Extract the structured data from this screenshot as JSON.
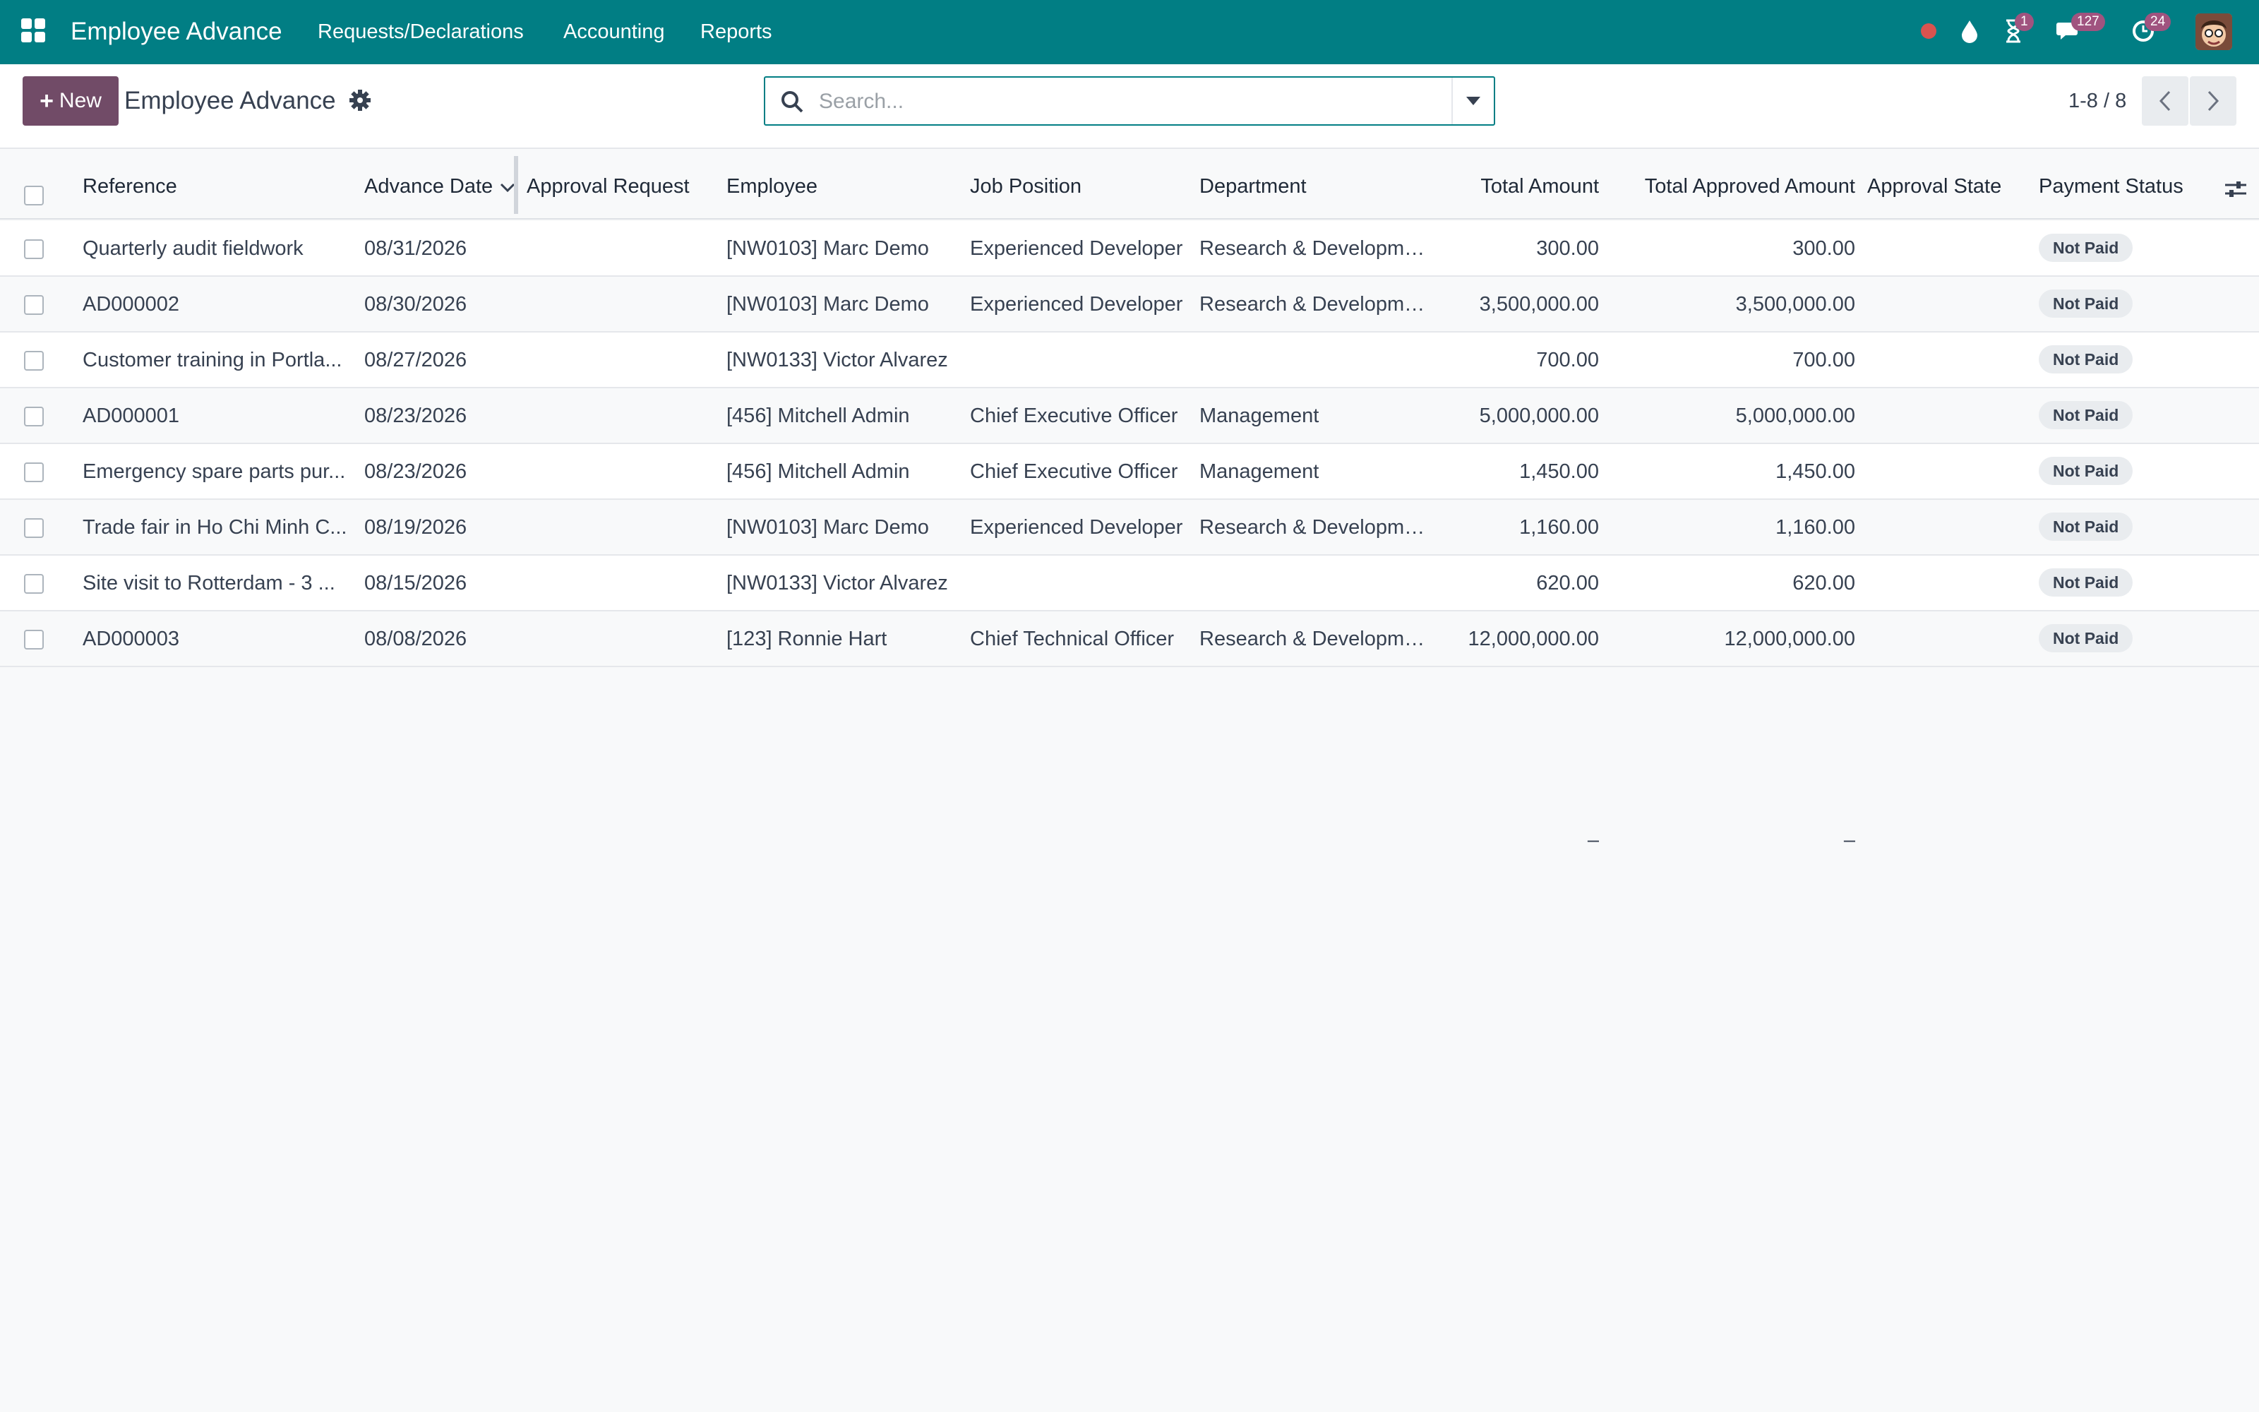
{
  "navbar": {
    "app_title": "Employee Advance",
    "menus": [
      "Requests/Declarations",
      "Accounting",
      "Reports"
    ],
    "activity_badge": "1",
    "messages_badge": "127",
    "updates_badge": "24",
    "brand_color": "#017e84"
  },
  "control_panel": {
    "new_label": "New",
    "breadcrumb": "Employee Advance",
    "search_placeholder": "Search...",
    "pager": "1-8 / 8",
    "accent_color": "#714b67"
  },
  "table": {
    "columns": {
      "reference": "Reference",
      "advance_date": "Advance Date",
      "approval_request": "Approval Request",
      "employee": "Employee",
      "job_position": "Job Position",
      "department": "Department",
      "total_amount": "Total Amount",
      "total_approved_amount": "Total Approved Amount",
      "approval_state": "Approval State",
      "payment_status": "Payment Status"
    },
    "rows": [
      {
        "reference": "Quarterly audit fieldwork",
        "date": "08/31/2026",
        "approval_request": "",
        "employee": "[NW0103] Marc Demo",
        "job": "Experienced Developer",
        "department": "Research & Development",
        "total": "300.00",
        "approved": "300.00",
        "approval_state": "",
        "payment": "Not Paid"
      },
      {
        "reference": "AD000002",
        "date": "08/30/2026",
        "approval_request": "",
        "employee": "[NW0103] Marc Demo",
        "job": "Experienced Developer",
        "department": "Research & Development",
        "total": "3,500,000.00",
        "approved": "3,500,000.00",
        "approval_state": "",
        "payment": "Not Paid"
      },
      {
        "reference": "Customer training in Portla...",
        "date": "08/27/2026",
        "approval_request": "",
        "employee": "[NW0133] Victor Alvarez",
        "job": "",
        "department": "",
        "total": "700.00",
        "approved": "700.00",
        "approval_state": "",
        "payment": "Not Paid"
      },
      {
        "reference": "AD000001",
        "date": "08/23/2026",
        "approval_request": "",
        "employee": "[456] Mitchell Admin",
        "job": "Chief Executive Officer",
        "department": "Management",
        "total": "5,000,000.00",
        "approved": "5,000,000.00",
        "approval_state": "",
        "payment": "Not Paid"
      },
      {
        "reference": "Emergency spare parts pur...",
        "date": "08/23/2026",
        "approval_request": "",
        "employee": "[456] Mitchell Admin",
        "job": "Chief Executive Officer",
        "department": "Management",
        "total": "1,450.00",
        "approved": "1,450.00",
        "approval_state": "",
        "payment": "Not Paid"
      },
      {
        "reference": "Trade fair in Ho Chi Minh C...",
        "date": "08/19/2026",
        "approval_request": "",
        "employee": "[NW0103] Marc Demo",
        "job": "Experienced Developer",
        "department": "Research & Development",
        "total": "1,160.00",
        "approved": "1,160.00",
        "approval_state": "",
        "payment": "Not Paid"
      },
      {
        "reference": "Site visit to Rotterdam - 3 ...",
        "date": "08/15/2026",
        "approval_request": "",
        "employee": "[NW0133] Victor Alvarez",
        "job": "",
        "department": "",
        "total": "620.00",
        "approved": "620.00",
        "approval_state": "",
        "payment": "Not Paid"
      },
      {
        "reference": "AD000003",
        "date": "08/08/2026",
        "approval_request": "",
        "employee": "[123] Ronnie Hart",
        "job": "Chief Technical Officer",
        "department": "Research & Development",
        "total": "12,000,000.00",
        "approved": "12,000,000.00",
        "approval_state": "",
        "payment": "Not Paid"
      }
    ],
    "footer": {
      "total": "–",
      "approved": "–"
    }
  }
}
